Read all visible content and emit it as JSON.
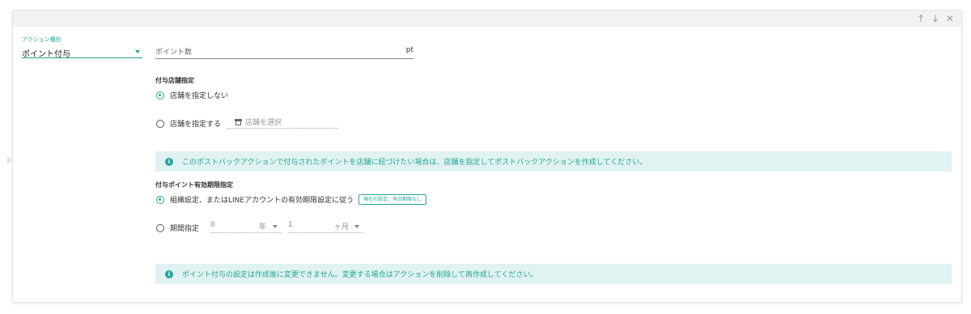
{
  "header": {
    "up_icon": "↑",
    "down_icon": "↓",
    "close_icon": "✕"
  },
  "action_type": {
    "label": "アクション種別",
    "value": "ポイント付与"
  },
  "points": {
    "placeholder": "ポイント数",
    "unit": "pt"
  },
  "store_section": {
    "title": "付与店舗指定",
    "option_none": "店舗を指定しない",
    "option_specify": "店舗を指定する",
    "store_select_placeholder": "店舗を選択"
  },
  "info1": {
    "icon": "i",
    "text": "このポストバックアクションで付与されたポイントを店舗に紐づけたい場合は、店舗を指定してポストバックアクションを作成してください。"
  },
  "expiry_section": {
    "title": "付与ポイント有効期限指定",
    "option_org": "組織設定、またはLINEアカウントの有効期限設定に従う",
    "current_badge": "現在の設定：有効期限なし",
    "option_period": "期間指定",
    "years_value": "0",
    "years_suffix": "年",
    "months_value": "1",
    "months_suffix": "ヶ月"
  },
  "info2": {
    "icon": "i",
    "text": "ポイント付与の設定は作成後に変更できません。変更する場合はアクションを削除して再作成してください。"
  },
  "colors": {
    "accent": "#26a69a",
    "info_bg": "#e0f2f1"
  }
}
